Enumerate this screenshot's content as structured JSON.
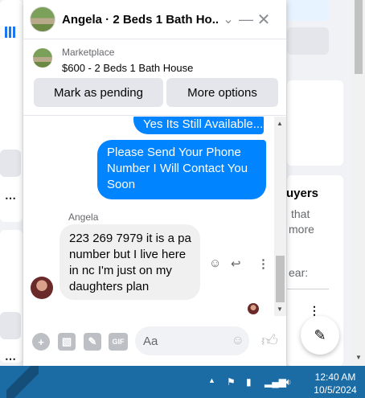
{
  "background": {
    "right_heading": "uyers",
    "right_lines": [
      "that",
      "more",
      "ear:"
    ]
  },
  "chat": {
    "title": "Angela · 2 Beds 1 Bath Ho...",
    "listing": {
      "source": "Marketplace",
      "title": "$600 - 2 Beds 1 Bath House"
    },
    "buttons": {
      "pending": "Mark as pending",
      "more": "More options"
    },
    "messages": [
      {
        "direction": "outgoing",
        "lines": [
          "Yes Its Still Available..."
        ]
      },
      {
        "direction": "outgoing",
        "lines": [
          "Please Send Your Phone",
          "Number I Will Contact You",
          "Soon"
        ]
      },
      {
        "direction": "incoming",
        "sender": "Angela",
        "lines": [
          "223 269 7979 it is a pa",
          "number but I live here",
          "in nc I'm just on my",
          "daughters plan"
        ]
      }
    ],
    "composer": {
      "placeholder": "Aa"
    }
  },
  "taskbar": {
    "time": "12:40 AM",
    "date": "10/5/2024"
  },
  "colors": {
    "accent": "#0084ff",
    "taskbar": "#1b6ba5"
  }
}
